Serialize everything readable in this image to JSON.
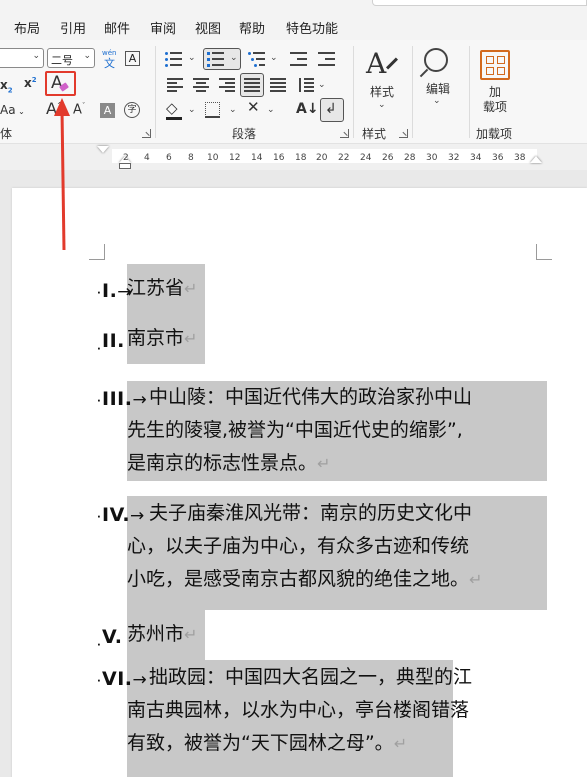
{
  "tabs": [
    "布局",
    "引用",
    "邮件",
    "审阅",
    "视图",
    "帮助",
    "特色功能"
  ],
  "ribbon": {
    "font_size_value": "二号",
    "wen_glyph_top": "wén",
    "wen_glyph_bottom": "文",
    "boxed_A": "A",
    "subscript": "x",
    "subscript_mark": "2",
    "superscript": "x",
    "superscript_mark": "2",
    "clear_format_letter": "A",
    "change_case": "Aa",
    "grow_font": "A",
    "shrink_font": "A",
    "char_shading": "A",
    "enclose_char": "字",
    "font_group_label": "体",
    "paragraph_group_label": "段落",
    "styles_label": "样式",
    "styles_group_label": "样式",
    "edit_label": "编辑",
    "addin_label_1": "加",
    "addin_label_2": "载项",
    "addins_group_label": "加载项"
  },
  "ruler": {
    "ticks": [
      "2",
      "4",
      "6",
      "8",
      "10",
      "12",
      "14",
      "16",
      "18",
      "20",
      "22",
      "24",
      "26",
      "28",
      "30",
      "32",
      "34",
      "36",
      "38"
    ]
  },
  "document": {
    "items": [
      {
        "marker": "I.",
        "lines": [
          "江苏省"
        ]
      },
      {
        "marker": "II.",
        "lines": [
          "南京市"
        ]
      },
      {
        "marker": "III.",
        "lines": [
          "中山陵：中国近代伟大的政治家孙中山",
          "先生的陵寝,被誉为“中国近代史的缩影”,",
          "是南京的标志性景点。"
        ]
      },
      {
        "marker": "IV.",
        "lines": [
          "夫子庙秦淮风光带：南京的历史文化中",
          "心，以夫子庙为中心，有众多古迹和传统",
          "小吃，是感受南京古都风貌的绝佳之地。"
        ]
      },
      {
        "marker": "V.",
        "lines": [
          "苏州市"
        ]
      },
      {
        "marker": "VI.",
        "lines": [
          "拙政园：中国四大名园之一，典型的江",
          "南古典园林，以水为中心，亭台楼阁错落",
          "有致，被誉为“天下园林之母”。"
        ]
      }
    ],
    "tab_arrow": "→",
    "para_mark": "↵",
    "bullet_dot": "·"
  }
}
